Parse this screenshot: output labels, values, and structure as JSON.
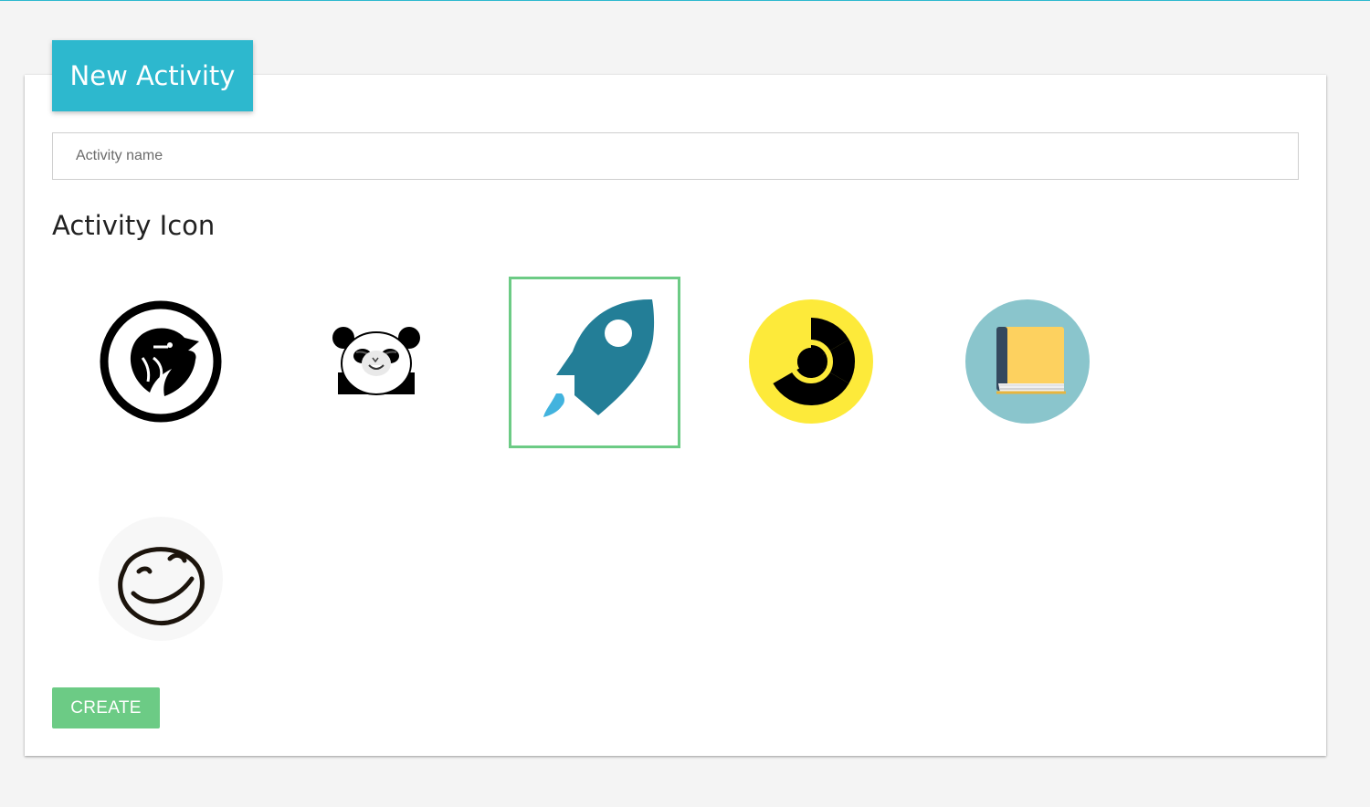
{
  "header": {
    "title": "New Activity"
  },
  "form": {
    "name_placeholder": "Activity name",
    "name_value": "",
    "icon_section_title": "Activity Icon"
  },
  "icons": [
    {
      "name": "eagle-icon",
      "selected": false
    },
    {
      "name": "panda-meme-icon",
      "selected": false
    },
    {
      "name": "rocket-icon",
      "selected": true
    },
    {
      "name": "radiation-icon",
      "selected": false
    },
    {
      "name": "book-icon",
      "selected": false
    },
    {
      "name": "smiley-icon",
      "selected": false
    }
  ],
  "actions": {
    "create_label": "CREATE"
  },
  "colors": {
    "accent": "#2db8ce",
    "selection_border": "#6ccb85",
    "create_button": "#6ccb85"
  }
}
